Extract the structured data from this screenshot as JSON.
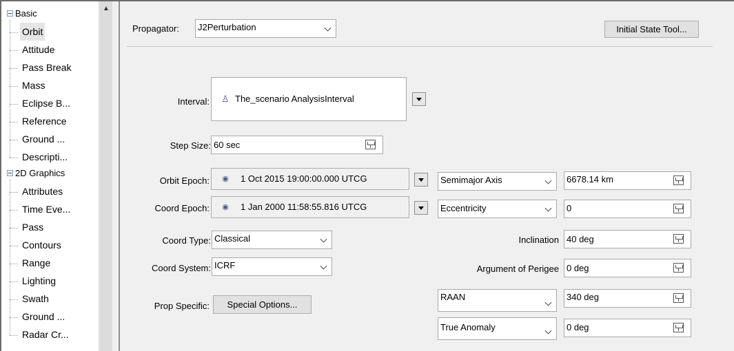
{
  "tree": {
    "groups": [
      {
        "label": "Basic",
        "items": [
          "Orbit",
          "Attitude",
          "Pass Break",
          "Mass",
          "Eclipse B...",
          "Reference",
          "Ground ...",
          "Descripti..."
        ]
      },
      {
        "label": "2D Graphics",
        "items": [
          "Attributes",
          "Time Eve...",
          "Pass",
          "Contours",
          "Range",
          "Lighting",
          "Swath",
          "Ground ...",
          "Radar Cr..."
        ]
      }
    ],
    "selected": "Orbit"
  },
  "propagator": {
    "label": "Propagator:",
    "value": "J2Perturbation"
  },
  "initial_state_button": "Initial State Tool...",
  "interval": {
    "label": "Interval:",
    "value": "The_scenario AnalysisInterval"
  },
  "step_size": {
    "label": "Step Size:",
    "value": "60 sec"
  },
  "orbit_epoch": {
    "label": "Orbit Epoch:",
    "value": "1 Oct 2015 19:00:00.000 UTCG"
  },
  "coord_epoch": {
    "label": "Coord Epoch:",
    "value": "1 Jan 2000 11:58:55.816 UTCG"
  },
  "coord_type": {
    "label": "Coord Type:",
    "value": "Classical"
  },
  "coord_system": {
    "label": "Coord System:",
    "value": "ICRF"
  },
  "prop_specific": {
    "label": "Prop Specific:",
    "button": "Special Options..."
  },
  "elements": {
    "semimajor": {
      "label": "Semimajor Axis",
      "value": "6678.14 km"
    },
    "eccentricity": {
      "label": "Eccentricity",
      "value": "0"
    },
    "inclination": {
      "label": "Inclination",
      "value": "40 deg"
    },
    "arg_perigee": {
      "label": "Argument of Perigee",
      "value": "0 deg"
    },
    "raan": {
      "label": "RAAN",
      "value": "340 deg"
    },
    "true_anomaly": {
      "label": "True Anomaly",
      "value": "0 deg"
    }
  }
}
